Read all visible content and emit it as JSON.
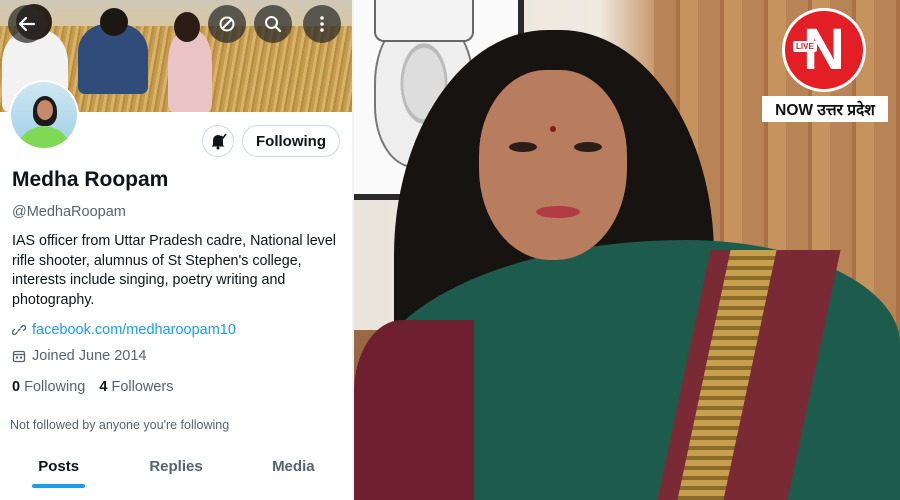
{
  "profile": {
    "name": "Medha Roopam",
    "handle": "@MedhaRoopam",
    "bio": "IAS officer from Uttar Pradesh cadre, National level rifle shooter, alumnus of St Stephen's college, interests include singing, poetry writing and photography.",
    "link": "facebook.com/medharoopam10",
    "joined": "Joined June 2014",
    "following_count": "0",
    "following_label": "Following",
    "followers_count": "4",
    "followers_label": "Followers",
    "not_followed_text": "Not followed by anyone you're following",
    "follow_button_label": "Following"
  },
  "header_actions": {
    "back_icon": "back-arrow-icon",
    "refresh_icon": "refresh-icon",
    "search_icon": "search-icon",
    "more_icon": "more-vertical-icon"
  },
  "tabs": [
    {
      "label": "Posts",
      "active": true
    },
    {
      "label": "Replies",
      "active": false
    },
    {
      "label": "Media",
      "active": false
    }
  ],
  "watermark": {
    "logo_letter": "N",
    "live_badge": "LIVE",
    "brand_text": "NOW उत्तर प्रदेश"
  },
  "colors": {
    "accent": "#1d9bf0",
    "text_primary": "#0f1419",
    "text_secondary": "#536471",
    "brand_red": "#e31e24"
  }
}
